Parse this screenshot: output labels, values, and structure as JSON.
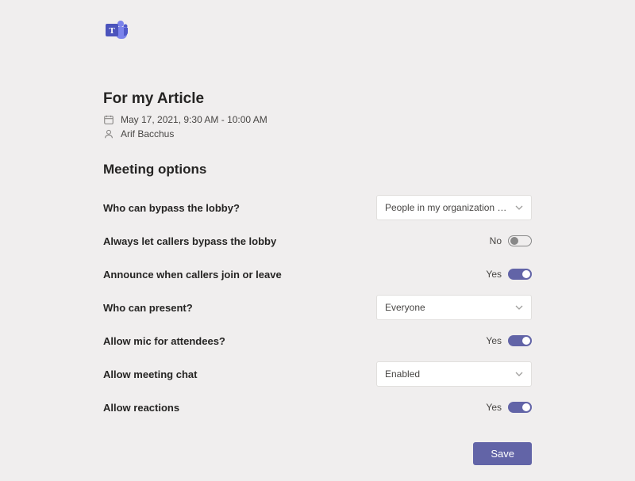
{
  "meeting": {
    "title": "For my Article",
    "datetime": "May 17, 2021, 9:30 AM - 10:00 AM",
    "organizer": "Arif Bacchus"
  },
  "section_title": "Meeting options",
  "options": {
    "bypass_lobby": {
      "label": "Who can bypass the lobby?",
      "value": "People in my organization and gu…"
    },
    "callers_bypass": {
      "label": "Always let callers bypass the lobby",
      "state_text": "No"
    },
    "announce": {
      "label": "Announce when callers join or leave",
      "state_text": "Yes"
    },
    "present": {
      "label": "Who can present?",
      "value": "Everyone"
    },
    "mic": {
      "label": "Allow mic for attendees?",
      "state_text": "Yes"
    },
    "chat": {
      "label": "Allow meeting chat",
      "value": "Enabled"
    },
    "reactions": {
      "label": "Allow reactions",
      "state_text": "Yes"
    }
  },
  "save_label": "Save"
}
